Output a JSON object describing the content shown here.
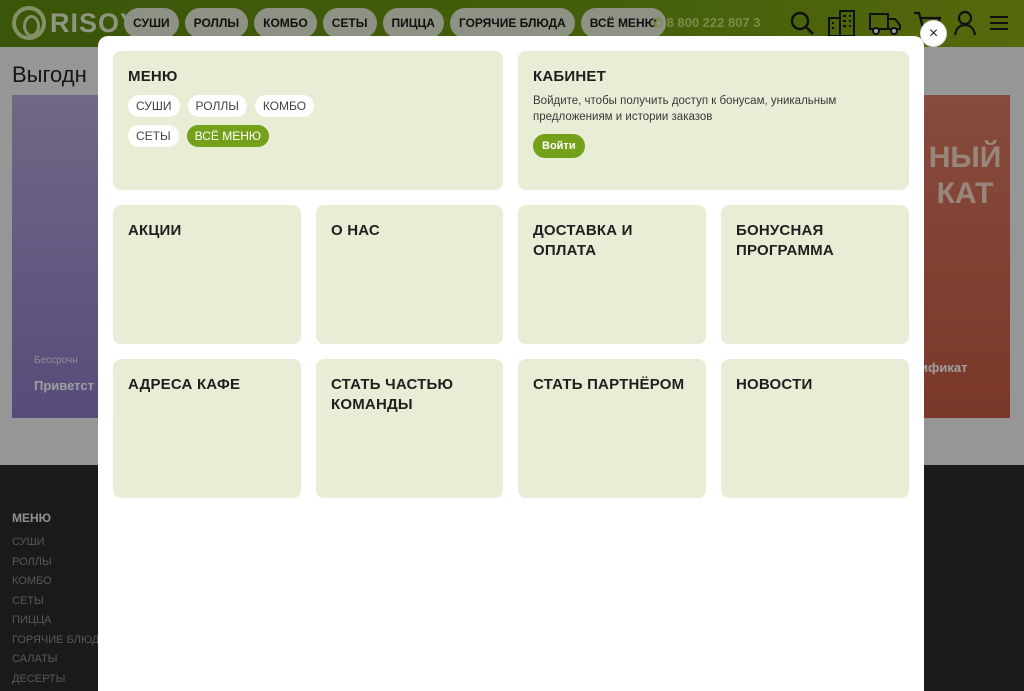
{
  "header": {
    "logo_text": "RISOY",
    "nav": [
      "СУШИ",
      "РОЛЛЫ",
      "КОМБО",
      "СЕТЫ",
      "ПИЦЦА",
      "ГОРЯЧИЕ БЛЮДА",
      "ВСЁ МЕНЮ"
    ],
    "phone": "8 800 222 807 3"
  },
  "page": {
    "heading": "Выгодн",
    "banner_left": {
      "small": "Бессрочн",
      "big": "Приветст"
    },
    "banner_right": {
      "title": "НЫЙ\nКАТ",
      "big": "ификат"
    }
  },
  "footer": {
    "title": "МЕНЮ",
    "links": [
      "СУШИ",
      "РОЛЛЫ",
      "КОМБО",
      "СЕТЫ",
      "ПИЦЦА",
      "ГОРЯЧИЕ БЛЮД",
      "САЛАТЫ",
      "ДЕСЕРТЫ"
    ]
  },
  "modal": {
    "close": "×",
    "menu": {
      "title": "МЕНЮ",
      "pills": [
        "СУШИ",
        "РОЛЛЫ",
        "КОМБО",
        "СЕТЫ",
        "ВСЁ МЕНЮ"
      ]
    },
    "cabinet": {
      "title": "КАБИНЕТ",
      "text": "Войдите, чтобы получить доступ к бонусам, уникальным предложениям и истории заказов",
      "login": "Войти"
    },
    "cards": [
      "АКЦИИ",
      "О НАС",
      "ДОСТАВКА И ОПЛАТА",
      "БОНУСНАЯ ПРОГРАММА",
      "АДРЕСА КАФЕ",
      "СТАТЬ ЧАСТЬЮ КОМАНДЫ",
      "СТАТЬ ПАРТНЁРОМ",
      "НОВОСТИ"
    ]
  },
  "colors": {
    "brand_green": "#74a01a",
    "card_bg": "#e7eed5",
    "footer_bg": "#2a2a2a"
  },
  "icons": [
    "search-icon",
    "buildings-icon",
    "truck-icon",
    "cart-icon",
    "user-icon",
    "menu-icon",
    "phone-icon"
  ]
}
